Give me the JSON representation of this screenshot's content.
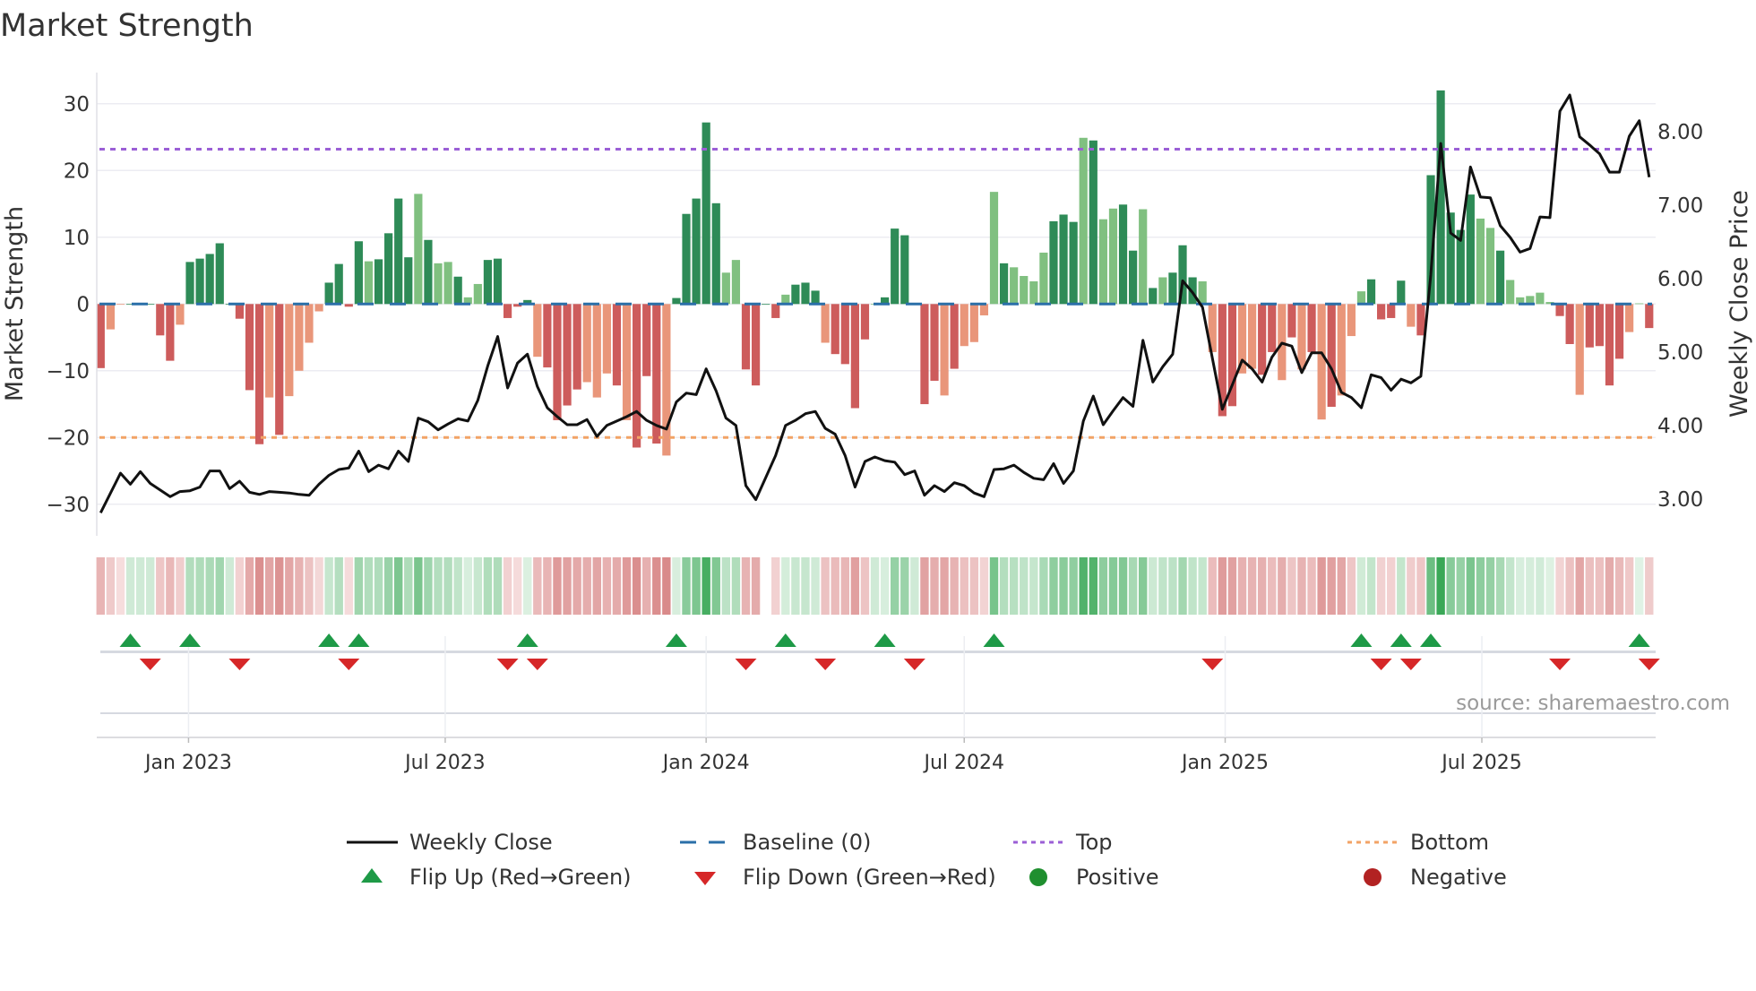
{
  "chart_data": {
    "type": "bar",
    "title": "Market Strength",
    "ylabel": "Market Strength",
    "y2label": "Weekly Close Price",
    "ylim": [
      -35,
      35
    ],
    "y2lim": [
      2.6,
      8.9
    ],
    "x_start": "2022-10-31",
    "x_interval": "weekly",
    "yticks": [
      "30",
      "20",
      "10",
      "0",
      "−10",
      "−20",
      "−30"
    ],
    "ytick_values": [
      30,
      20,
      10,
      0,
      -10,
      -20,
      -30
    ],
    "y2ticks": [
      "8.00",
      "7.00",
      "6.00",
      "5.00",
      "4.00",
      "3.00"
    ],
    "y2tick_values": [
      8,
      7,
      6,
      5,
      4,
      3
    ],
    "xticks": [
      {
        "label": "Jan 2023",
        "date": "2023-01-01"
      },
      {
        "label": "Jul 2023",
        "date": "2023-07-01"
      },
      {
        "label": "Jan 2024",
        "date": "2024-01-01"
      },
      {
        "label": "Jul 2024",
        "date": "2024-07-01"
      },
      {
        "label": "Jan 2025",
        "date": "2025-01-01"
      },
      {
        "label": "Jul 2025",
        "date": "2025-07-01"
      }
    ],
    "top_level": 23.2,
    "bottom_level": -20,
    "strength_values": [
      -9.6,
      -3.8,
      -0.1,
      0,
      0,
      0,
      -4.7,
      -8.5,
      -3.1,
      6.3,
      6.8,
      7.5,
      9.1,
      0,
      -2.2,
      -12.9,
      -21.0,
      -14.0,
      -19.6,
      -13.8,
      -10.0,
      -5.8,
      -1.1,
      3.2,
      6.0,
      -0.4,
      9.4,
      6.4,
      6.7,
      10.6,
      15.8,
      7.0,
      16.5,
      9.6,
      6.1,
      6.3,
      4.1,
      1.0,
      3.0,
      6.6,
      6.8,
      -2.1,
      -0.4,
      0.6,
      -7.9,
      -9.5,
      -17.4,
      -15.2,
      -12.8,
      -11.7,
      -14.0,
      -10.4,
      -12.2,
      -17.4,
      -21.5,
      -10.8,
      -20.9,
      -22.7,
      0.9,
      13.5,
      15.8,
      27.2,
      15.1,
      4.7,
      6.6,
      -9.8,
      -12.2,
      0,
      -2.1,
      1.4,
      2.9,
      3.2,
      2.0,
      -5.8,
      -7.5,
      -9.0,
      -15.6,
      -5.3,
      0,
      1.0,
      11.3,
      10.3,
      0,
      -15.0,
      -11.5,
      -13.7,
      -9.7,
      -6.3,
      -5.7,
      -1.7,
      16.8,
      6.1,
      5.5,
      4.2,
      3.4,
      7.7,
      12.4,
      13.4,
      12.3,
      24.9,
      24.5,
      12.7,
      14.3,
      14.9,
      8.0,
      14.2,
      2.4,
      4.0,
      4.7,
      8.8,
      4.0,
      3.4,
      -7.2,
      -16.8,
      -15.3,
      -10.4,
      -9.7,
      -10.6,
      -7.2,
      -11.4,
      -5.0,
      -9.8,
      -7.2,
      -17.3,
      -15.4,
      -13.7,
      -4.8,
      1.9,
      3.7,
      -2.3,
      -2.1,
      3.5,
      -3.4,
      -4.7,
      19.3,
      32.0,
      13.7,
      11.1,
      16.4,
      12.8,
      11.4,
      8.0,
      3.6,
      1.0,
      1.2,
      1.7,
      0.3,
      -1.8,
      -6.0,
      -13.6,
      -6.5,
      -6.3,
      -12.2,
      -8.2,
      -4.2,
      0.1,
      -3.6
    ],
    "strength_shade": "dlldddddlddddddddldllllddddlddddldlldlldddddlddddllldldddldddddllddddldddlddddldddlddldlllldlllldddldllddldldddllddllddldldldlllddddlddddddlldlllllddlddddlldlldd",
    "weekly_close": [
      2.81,
      3.08,
      3.35,
      3.2,
      3.37,
      3.21,
      3.12,
      3.03,
      3.1,
      3.11,
      3.16,
      3.38,
      3.38,
      3.14,
      3.24,
      3.09,
      3.06,
      3.1,
      3.09,
      3.08,
      3.06,
      3.05,
      3.2,
      3.32,
      3.4,
      3.42,
      3.65,
      3.37,
      3.46,
      3.41,
      3.65,
      3.51,
      4.1,
      4.05,
      3.94,
      4.02,
      4.09,
      4.06,
      4.34,
      4.81,
      5.21,
      4.51,
      4.85,
      4.97,
      4.53,
      4.24,
      4.12,
      4.01,
      4.01,
      4.08,
      3.85,
      4.0,
      4.06,
      4.12,
      4.19,
      4.07,
      4.0,
      3.95,
      4.32,
      4.44,
      4.42,
      4.77,
      4.47,
      4.1,
      4.0,
      3.18,
      2.99,
      3.29,
      3.59,
      4.0,
      4.07,
      4.16,
      4.19,
      3.96,
      3.88,
      3.59,
      3.16,
      3.51,
      3.57,
      3.52,
      3.5,
      3.33,
      3.38,
      3.05,
      3.18,
      3.1,
      3.22,
      3.18,
      3.08,
      3.03,
      3.4,
      3.41,
      3.46,
      3.36,
      3.28,
      3.26,
      3.48,
      3.21,
      3.38,
      4.06,
      4.4,
      4.01,
      4.2,
      4.38,
      4.26,
      5.16,
      4.59,
      4.8,
      4.97,
      5.97,
      5.81,
      5.61,
      4.91,
      4.22,
      4.55,
      4.89,
      4.77,
      4.59,
      4.93,
      5.12,
      5.08,
      4.72,
      4.99,
      4.99,
      4.77,
      4.45,
      4.38,
      4.24,
      4.69,
      4.65,
      4.48,
      4.63,
      4.58,
      4.67,
      6.05,
      7.84,
      6.62,
      6.52,
      7.52,
      7.11,
      7.1,
      6.72,
      6.56,
      6.36,
      6.41,
      6.84,
      6.83,
      8.28,
      8.5,
      7.93,
      7.82,
      7.7,
      7.45,
      7.45,
      7.94,
      8.15,
      7.38
    ],
    "heatmap_missing_weeks": [
      67
    ],
    "flip_up_weeks": [
      3,
      9,
      23,
      26,
      43,
      58,
      69,
      79,
      90,
      127,
      131,
      134,
      155
    ],
    "flip_down_weeks": [
      5,
      14,
      25,
      41,
      44,
      65,
      73,
      82,
      112,
      129,
      132,
      147,
      156
    ],
    "legend": [
      {
        "label": "Weekly Close",
        "symbol": "line-solid",
        "color": "#111111"
      },
      {
        "label": "Baseline (0)",
        "symbol": "line-dashed",
        "color": "#2a6fa8"
      },
      {
        "label": "Top",
        "symbol": "line-dotted",
        "color": "#9b5fd6"
      },
      {
        "label": "Bottom",
        "symbol": "line-dotted",
        "color": "#f2a366"
      },
      {
        "label": "Flip Up (Red→Green)",
        "symbol": "triangle-up",
        "color": "#1e9a47"
      },
      {
        "label": "Flip Down (Green→Red)",
        "symbol": "triangle-down",
        "color": "#d62728"
      },
      {
        "label": "Positive",
        "symbol": "circle",
        "color": "#1f8f2f"
      },
      {
        "label": "Negative",
        "symbol": "circle",
        "color": "#b22222"
      }
    ],
    "legend_position": "bottom-center",
    "source": "source: sharemaestro.com",
    "colors": {
      "pos_strong": "#2e8b57",
      "pos_weak": "#80c080",
      "neg_strong": "#cd5c5c",
      "neg_weak": "#e9967a",
      "price_line": "#111111",
      "grid": "#ececf2"
    }
  }
}
